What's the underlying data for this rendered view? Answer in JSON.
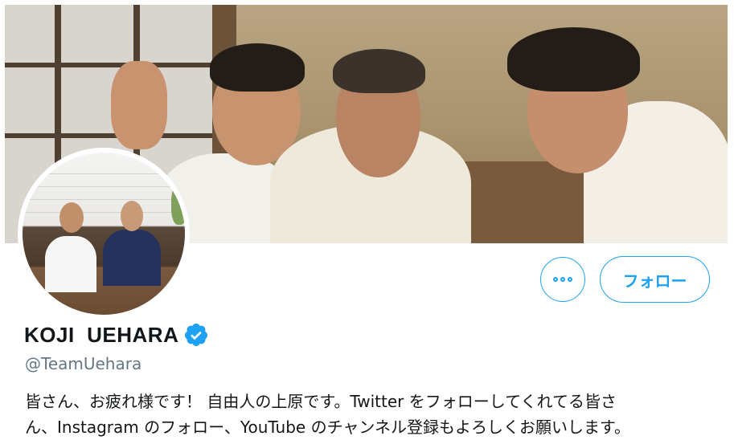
{
  "profile": {
    "display_name": "KOJI  UEHARA",
    "handle": "@TeamUehara",
    "verified": true,
    "bio_line1": "皆さん、お疲れ様です！ 自由人の上原です。Twitter をフォローしてくれてる皆さ",
    "bio_line2": "ん、Instagram のフォロー、YouTube のチャンネル登録もよろしくお願いします。"
  },
  "actions": {
    "more_icon": "more-dots-icon",
    "follow_label": "フォロー"
  },
  "icons": {
    "verified": "verified-badge-icon"
  },
  "colors": {
    "accent": "#1da1f2",
    "text_primary": "#14171a",
    "text_secondary": "#657786"
  }
}
